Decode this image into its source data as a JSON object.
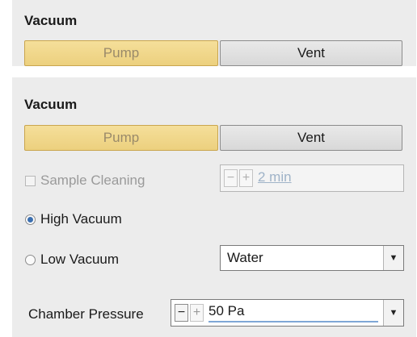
{
  "top_section": {
    "title": "Vacuum",
    "pump_label": "Pump",
    "vent_label": "Vent"
  },
  "main_section": {
    "title": "Vacuum",
    "pump_label": "Pump",
    "vent_label": "Vent",
    "sample_cleaning": {
      "label": "Sample Cleaning",
      "checked": false,
      "enabled": false,
      "minus_glyph": "−",
      "plus_glyph": "+",
      "value": "2 min"
    },
    "high_vacuum": {
      "label": "High Vacuum",
      "selected": true
    },
    "low_vacuum": {
      "label": "Low Vacuum",
      "selected": false,
      "gas_value": "Water"
    },
    "chamber_pressure": {
      "label": "Chamber Pressure",
      "minus_glyph": "−",
      "plus_glyph": "+",
      "value": "50 Pa"
    }
  },
  "icons": {
    "dropdown_arrow": "▼"
  },
  "colors": {
    "panel_bg": "#ececec",
    "pump_button": "#f0d78a",
    "vent_button": "#e0e0e0",
    "radio_selected": "#3b6fb0",
    "value_underline": "#7fa7d6"
  }
}
